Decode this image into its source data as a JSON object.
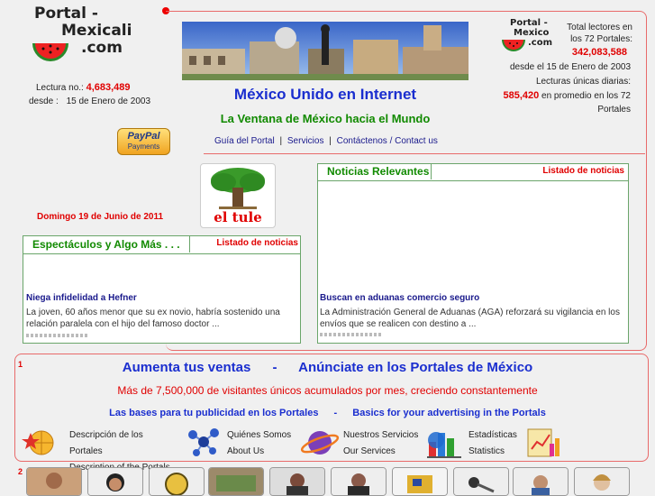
{
  "header": {
    "logo_line1": "Portal -",
    "logo_line2": "Mexicali",
    "logo_line3": ".com",
    "lectura_label": "Lectura no.:",
    "lectura_value": "4,683,489",
    "desde_label": "desde :",
    "desde_value": "15 de Enero de 2003",
    "title": "México Unido en Internet",
    "subtitle": "La Ventana de México hacia el Mundo",
    "nav": [
      "Guía del Portal",
      "Servicios",
      "Contáctenos / Contact us"
    ],
    "nav_sep": "|",
    "paypal_line1": "PayPal",
    "paypal_line2": "Payments"
  },
  "stats": {
    "logo_line1": "Portal -",
    "logo_line2": "Mexico",
    "logo_line3": ".com",
    "total_label_1": "Total lectores en",
    "total_label_2": "los 72 Portales:",
    "total_value": "342,083,588",
    "since": "desde el 15 de Enero de 2003",
    "unique_label": "Lecturas únicas diarias:",
    "unique_value": "585,420",
    "unique_suffix_1": "en promedio en los 72",
    "unique_suffix_2": "Portales"
  },
  "date": "Domingo 19 de Junio de 2011",
  "tule_label": "el tule",
  "noticias": {
    "title": "Noticias Relevantes",
    "list_link": "Listado de noticias",
    "headline": "Buscan en aduanas comercio seguro",
    "body": "La Administración General de Aduanas (AGA) reforzará su vigilancia en los envíos que se realicen con destino a ..."
  },
  "espectaculos": {
    "title": "Espectáculos y Algo Más . . .",
    "list_link": "Listado de noticias",
    "headline": "Niega infidelidad a Hefner",
    "body": "La joven, 60 años menor que su ex novio, habría sostenido una relación paralela con el hijo del famoso doctor ..."
  },
  "ad": {
    "index": "1",
    "headline_left": "Aumenta tus ventas",
    "headline_sep": "-",
    "headline_right": "Anúnciate en los Portales de México",
    "subline": "Más de 7,500,000 de visitantes únicos acumulados por mes, creciendo constantemente",
    "bases_es": "Las bases para tu publicidad en los Portales",
    "bases_sep": "-",
    "bases_en": "Basics for your advertising in the Portals",
    "links": [
      {
        "es": "Descripción de los Portales",
        "en": "Description of the Portals",
        "icon": "globe-star-icon"
      },
      {
        "es": "Quiénes Somos",
        "en": "About Us",
        "icon": "molecule-icon"
      },
      {
        "es": "Nuestros Servicios",
        "en": "Our Services",
        "icon": "planet-icon"
      },
      {
        "es": "Estadísticas",
        "en": "Statistics",
        "icon": "bar-chart-icon"
      }
    ]
  },
  "bottom_index": "2"
}
